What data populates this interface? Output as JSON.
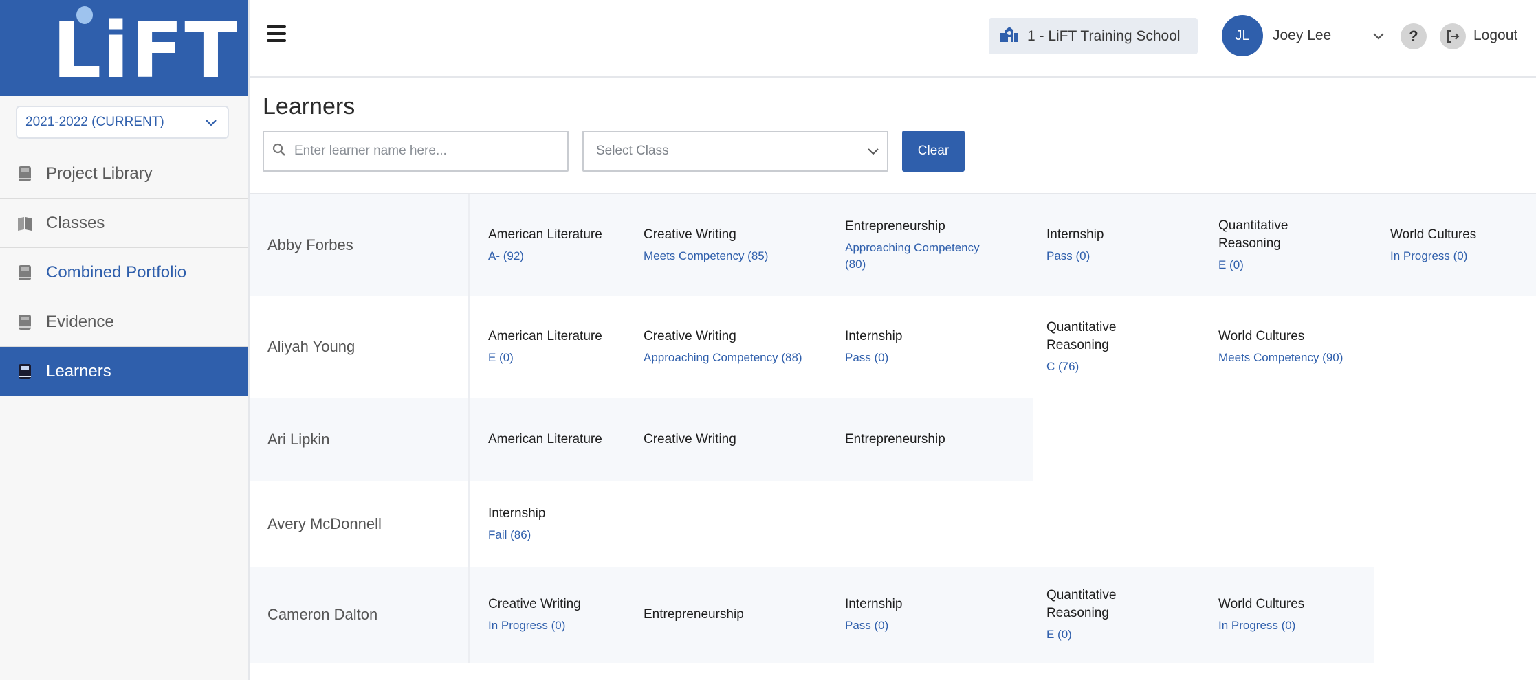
{
  "app": {
    "logo_text": "LiFT"
  },
  "sidebar": {
    "year_select": "2021-2022 (CURRENT)",
    "items": [
      {
        "label": "Project Library"
      },
      {
        "label": "Classes"
      },
      {
        "label": "Combined Portfolio"
      },
      {
        "label": "Evidence"
      },
      {
        "label": "Learners"
      }
    ]
  },
  "header": {
    "school": "1 - LiFT Training School",
    "user_initials": "JL",
    "user_name": "Joey Lee",
    "help_label": "?",
    "logout_label": "Logout"
  },
  "page": {
    "title": "Learners",
    "search_placeholder": "Enter learner name here...",
    "class_select": "Select Class",
    "clear_label": "Clear"
  },
  "learners": [
    {
      "name": "Abby Forbes",
      "courses": [
        {
          "name": "American Literature",
          "grade": "A- (92)"
        },
        {
          "name": "Creative Writing",
          "grade": "Meets Competency (85)"
        },
        {
          "name": "Entrepreneurship",
          "grade": "Approaching Competency (80)"
        },
        {
          "name": "Internship",
          "grade": "Pass (0)"
        },
        {
          "name": "Quantitative Reasoning",
          "grade": "E (0)"
        },
        {
          "name": "World Cultures",
          "grade": "In Progress (0)"
        }
      ]
    },
    {
      "name": "Aliyah Young",
      "courses": [
        {
          "name": "American Literature",
          "grade": "E (0)"
        },
        {
          "name": "Creative Writing",
          "grade": "Approaching Competency (88)"
        },
        {
          "name": "Internship",
          "grade": "Pass (0)"
        },
        {
          "name": "Quantitative Reasoning",
          "grade": "C (76)"
        },
        {
          "name": "World Cultures",
          "grade": "Meets Competency (90)"
        }
      ]
    },
    {
      "name": "Ari Lipkin",
      "courses": [
        {
          "name": "American Literature",
          "grade": ""
        },
        {
          "name": "Creative Writing",
          "grade": ""
        },
        {
          "name": "Entrepreneurship",
          "grade": ""
        }
      ]
    },
    {
      "name": "Avery McDonnell",
      "courses": [
        {
          "name": "Internship",
          "grade": "Fail (86)"
        }
      ]
    },
    {
      "name": "Cameron Dalton",
      "courses": [
        {
          "name": "Creative Writing",
          "grade": "In Progress (0)"
        },
        {
          "name": "Entrepreneurship",
          "grade": ""
        },
        {
          "name": "Internship",
          "grade": "Pass (0)"
        },
        {
          "name": "Quantitative Reasoning",
          "grade": "E (0)"
        },
        {
          "name": "World Cultures",
          "grade": "In Progress (0)"
        }
      ]
    }
  ]
}
